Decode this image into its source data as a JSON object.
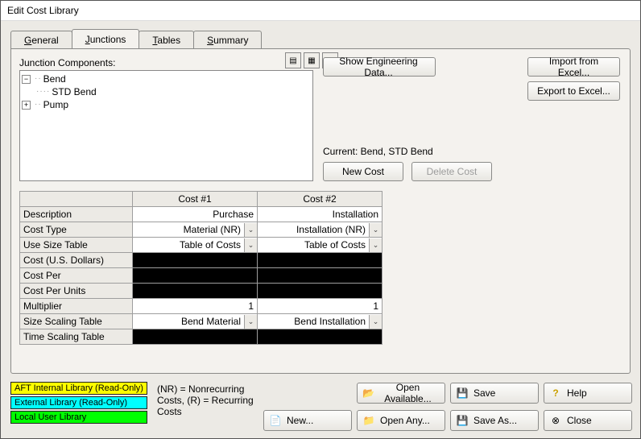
{
  "window": {
    "title": "Edit Cost Library"
  },
  "tabs": {
    "general": "General",
    "junctions": "Junctions",
    "tables": "Tables",
    "summary": "Summary"
  },
  "tree": {
    "label": "Junction Components:",
    "items": {
      "bend": "Bend",
      "std_bend": "STD Bend",
      "pump": "Pump"
    }
  },
  "buttons": {
    "show_eng": "Show Engineering Data...",
    "import_excel": "Import from Excel...",
    "export_excel": "Export to Excel...",
    "new_cost": "New Cost",
    "delete_cost": "Delete Cost",
    "open_avail": "Open Available...",
    "open_any": "Open Any...",
    "save": "Save",
    "save_as": "Save As...",
    "help": "Help",
    "close": "Close",
    "new": "New..."
  },
  "current": {
    "label": "Current: Bend, STD Bend"
  },
  "grid": {
    "headers": {
      "c1": "Cost #1",
      "c2": "Cost #2"
    },
    "rows": {
      "description": "Description",
      "cost_type": "Cost Type",
      "use_size": "Use Size Table",
      "cost_usd": "Cost (U.S. Dollars)",
      "cost_per": "Cost Per",
      "cost_per_units": "Cost Per Units",
      "multiplier": "Multiplier",
      "size_scaling": "Size Scaling Table",
      "time_scaling": "Time Scaling Table"
    },
    "values": {
      "c1": {
        "description": "Purchase",
        "cost_type": "Material (NR)",
        "use_size": "Table of Costs",
        "multiplier": "1",
        "size_scaling": "Bend Material"
      },
      "c2": {
        "description": "Installation",
        "cost_type": "Installation (NR)",
        "use_size": "Table of Costs",
        "multiplier": "1",
        "size_scaling": "Bend Installation"
      }
    }
  },
  "legend": {
    "internal": "AFT Internal Library (Read-Only)",
    "external": "External Library (Read-Only)",
    "local": "Local User Library"
  },
  "notes": {
    "nr": "(NR) = Nonrecurring Costs, (R) = Recurring Costs"
  }
}
